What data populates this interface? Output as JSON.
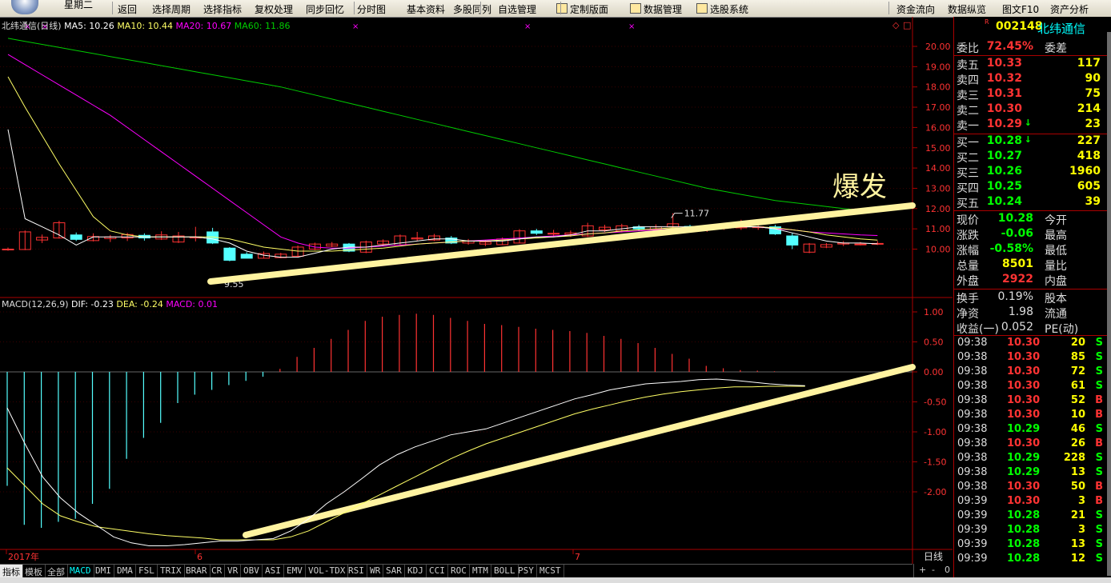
{
  "toolbar": {
    "weekday": "星期二",
    "items": [
      "返回",
      "选择周期",
      "选择指标",
      "复权处理",
      "同步回忆",
      "分时图",
      "基本资料",
      "多股同列",
      "自选管理",
      "定制版面",
      "数据管理",
      "选股系统",
      "资金流向",
      "数据纵览",
      "图文F10",
      "资产分析"
    ]
  },
  "kline_legend": {
    "title": "北纬通信(日线)",
    "ma5": "MA5: 10.26",
    "ma10": "MA10: 10.44",
    "ma20": "MA20: 10.67",
    "ma60": "MA60: 11.86"
  },
  "macd_legend": {
    "title": "MACD(12,26,9)",
    "dif": "DIF: -0.23",
    "dea": "DEA: -0.24",
    "macd": "MACD: 0.01"
  },
  "annotation": "爆发",
  "price_labels": {
    "high": "11.77",
    "low": "9.55"
  },
  "dates": [
    "2017年",
    "6",
    "7"
  ],
  "period_label": "日线",
  "price_axis": [
    "20.00",
    "19.00",
    "18.00",
    "17.00",
    "16.00",
    "15.00",
    "14.00",
    "13.00",
    "12.00",
    "11.00",
    "10.00"
  ],
  "macd_axis": [
    "1.00",
    "0.50",
    "0.00",
    "-0.50",
    "-1.00",
    "-1.50",
    "-2.00"
  ],
  "chart_data": {
    "type": "line",
    "ylim": [
      9.3,
      20.4
    ],
    "candles": [
      {
        "o": 10.0,
        "c": 10.0,
        "h": 10.08,
        "l": 9.92
      },
      {
        "o": 9.98,
        "c": 10.85,
        "h": 10.92,
        "l": 9.95
      },
      {
        "o": 10.45,
        "c": 10.58,
        "h": 10.72,
        "l": 10.3
      },
      {
        "o": 10.55,
        "c": 11.3,
        "h": 11.4,
        "l": 10.52
      },
      {
        "o": 10.7,
        "c": 10.48,
        "h": 10.82,
        "l": 10.4
      },
      {
        "o": 10.42,
        "c": 10.62,
        "h": 10.78,
        "l": 10.38
      },
      {
        "o": 10.52,
        "c": 10.6,
        "h": 10.7,
        "l": 10.35
      },
      {
        "o": 10.55,
        "c": 10.72,
        "h": 10.8,
        "l": 10.4
      },
      {
        "o": 10.68,
        "c": 10.55,
        "h": 10.78,
        "l": 10.42
      },
      {
        "o": 10.5,
        "c": 10.7,
        "h": 10.88,
        "l": 10.45
      },
      {
        "o": 10.35,
        "c": 10.65,
        "h": 10.85,
        "l": 10.3
      },
      {
        "o": 10.55,
        "c": 10.6,
        "h": 11.1,
        "l": 10.38
      },
      {
        "o": 10.85,
        "c": 10.3,
        "h": 11.05,
        "l": 10.25
      },
      {
        "o": 10.05,
        "c": 9.45,
        "h": 10.1,
        "l": 9.4
      },
      {
        "o": 9.75,
        "c": 9.55,
        "h": 9.85,
        "l": 9.55
      },
      {
        "o": 9.55,
        "c": 9.78,
        "h": 9.88,
        "l": 9.55
      },
      {
        "o": 9.58,
        "c": 9.75,
        "h": 9.82,
        "l": 9.55
      },
      {
        "o": 9.65,
        "c": 10.1,
        "h": 10.18,
        "l": 9.62
      },
      {
        "o": 10.0,
        "c": 10.25,
        "h": 10.32,
        "l": 9.95
      },
      {
        "o": 10.15,
        "c": 10.25,
        "h": 10.35,
        "l": 10.1
      },
      {
        "o": 10.25,
        "c": 9.9,
        "h": 10.3,
        "l": 9.85
      },
      {
        "o": 9.85,
        "c": 10.35,
        "h": 10.42,
        "l": 9.8
      },
      {
        "o": 10.25,
        "c": 10.4,
        "h": 10.48,
        "l": 10.15
      },
      {
        "o": 10.2,
        "c": 10.65,
        "h": 10.72,
        "l": 10.18
      },
      {
        "o": 10.5,
        "c": 10.55,
        "h": 10.85,
        "l": 10.4
      },
      {
        "o": 10.45,
        "c": 10.65,
        "h": 10.75,
        "l": 10.4
      },
      {
        "o": 10.55,
        "c": 10.3,
        "h": 10.65,
        "l": 10.25
      },
      {
        "o": 10.3,
        "c": 10.4,
        "h": 10.5,
        "l": 10.22
      },
      {
        "o": 10.25,
        "c": 10.35,
        "h": 10.45,
        "l": 10.15
      },
      {
        "o": 10.22,
        "c": 10.5,
        "h": 10.58,
        "l": 10.2
      },
      {
        "o": 10.3,
        "c": 10.9,
        "h": 10.98,
        "l": 10.28
      },
      {
        "o": 10.9,
        "c": 10.78,
        "h": 11.0,
        "l": 10.7
      },
      {
        "o": 10.75,
        "c": 10.78,
        "h": 10.95,
        "l": 10.62
      },
      {
        "o": 10.72,
        "c": 10.8,
        "h": 10.92,
        "l": 10.6
      },
      {
        "o": 10.65,
        "c": 11.15,
        "h": 11.3,
        "l": 10.6
      },
      {
        "o": 10.95,
        "c": 11.08,
        "h": 11.2,
        "l": 10.85
      },
      {
        "o": 10.9,
        "c": 11.15,
        "h": 11.25,
        "l": 10.82
      },
      {
        "o": 11.1,
        "c": 11.0,
        "h": 11.2,
        "l": 10.9
      },
      {
        "o": 10.98,
        "c": 11.1,
        "h": 11.22,
        "l": 10.88
      },
      {
        "o": 11.1,
        "c": 11.25,
        "h": 11.77,
        "l": 10.95
      },
      {
        "o": 11.12,
        "c": 11.0,
        "h": 11.2,
        "l": 10.9
      },
      {
        "o": 11.0,
        "c": 11.05,
        "h": 11.15,
        "l": 10.85
      },
      {
        "o": 11.05,
        "c": 11.1,
        "h": 11.25,
        "l": 10.95
      },
      {
        "o": 11.05,
        "c": 11.1,
        "h": 11.45,
        "l": 10.95
      },
      {
        "o": 11.1,
        "c": 11.1,
        "h": 11.2,
        "l": 10.95
      },
      {
        "o": 11.1,
        "c": 10.75,
        "h": 11.2,
        "l": 10.7
      },
      {
        "o": 10.65,
        "c": 10.2,
        "h": 10.8,
        "l": 10.0
      },
      {
        "o": 9.85,
        "c": 10.25,
        "h": 10.3,
        "l": 9.8
      },
      {
        "o": 10.1,
        "c": 10.22,
        "h": 10.3,
        "l": 10.05
      },
      {
        "o": 10.25,
        "c": 10.3,
        "h": 10.4,
        "l": 10.15
      },
      {
        "o": 10.22,
        "c": 10.25,
        "h": 10.35,
        "l": 10.18
      },
      {
        "o": 10.25,
        "c": 10.28,
        "h": 10.4,
        "l": 10.2
      }
    ],
    "ma5": [
      15.9,
      11.5,
      11.1,
      10.7,
      10.2,
      10.6,
      10.6,
      10.6,
      10.6,
      10.6,
      10.6,
      10.6,
      10.5,
      10.3,
      9.9,
      9.7,
      9.6,
      9.6,
      9.8,
      10.0,
      10.1,
      10.1,
      10.2,
      10.3,
      10.4,
      10.5,
      10.5,
      10.4,
      10.4,
      10.4,
      10.5,
      10.6,
      10.6,
      10.7,
      10.9,
      10.9,
      11.0,
      11.1,
      11.1,
      11.1,
      11.1,
      11.1,
      11.1,
      11.1,
      11.1,
      11.0,
      10.8,
      10.6,
      10.4,
      10.3,
      10.3,
      10.26
    ],
    "ma10": [
      18.5,
      17.0,
      15.6,
      14.2,
      12.9,
      11.6,
      10.9,
      10.7,
      10.6,
      10.6,
      10.6,
      10.6,
      10.6,
      10.5,
      10.3,
      10.1,
      10.0,
      9.9,
      9.9,
      9.9,
      9.95,
      10.0,
      10.05,
      10.15,
      10.25,
      10.3,
      10.35,
      10.4,
      10.4,
      10.45,
      10.5,
      10.55,
      10.6,
      10.65,
      10.75,
      10.8,
      10.9,
      10.95,
      11.0,
      11.05,
      11.05,
      11.1,
      11.1,
      11.1,
      11.1,
      11.05,
      10.95,
      10.85,
      10.7,
      10.6,
      10.5,
      10.44
    ],
    "ma20": [
      19.6,
      19.1,
      18.6,
      18.1,
      17.6,
      17.1,
      16.6,
      16.0,
      15.4,
      14.8,
      14.2,
      13.6,
      13.0,
      12.4,
      11.8,
      11.2,
      10.6,
      10.3,
      10.1,
      10.05,
      10.05,
      10.1,
      10.15,
      10.2,
      10.25,
      10.3,
      10.35,
      10.4,
      10.45,
      10.5,
      10.55,
      10.6,
      10.65,
      10.7,
      10.75,
      10.8,
      10.85,
      10.9,
      10.95,
      11.0,
      11.0,
      11.05,
      11.05,
      11.1,
      11.1,
      11.0,
      10.95,
      10.85,
      10.8,
      10.75,
      10.7,
      10.67
    ],
    "ma60": [
      20.4,
      20.25,
      20.1,
      19.95,
      19.8,
      19.65,
      19.5,
      19.35,
      19.2,
      19.05,
      18.9,
      18.75,
      18.6,
      18.45,
      18.3,
      18.15,
      18.0,
      17.8,
      17.6,
      17.4,
      17.2,
      17.0,
      16.8,
      16.6,
      16.4,
      16.2,
      16.0,
      15.8,
      15.6,
      15.4,
      15.2,
      15.0,
      14.8,
      14.6,
      14.4,
      14.2,
      14.0,
      13.8,
      13.6,
      13.4,
      13.2,
      13.0,
      12.85,
      12.7,
      12.55,
      12.4,
      12.3,
      12.2,
      12.1,
      12.0,
      11.92,
      11.86
    ],
    "macd_ylim": [
      -2.9,
      1.15
    ],
    "macd_hist": [
      -1.9,
      -2.55,
      -2.6,
      -2.5,
      -2.45,
      -2.2,
      -1.95,
      -1.45,
      -1.1,
      -0.85,
      -0.52,
      -0.38,
      -0.3,
      -0.22,
      -0.15,
      -0.08,
      0.05,
      0.25,
      0.4,
      0.55,
      0.7,
      0.85,
      0.92,
      0.95,
      0.97,
      0.95,
      0.9,
      0.85,
      0.8,
      0.78,
      0.75,
      0.72,
      0.7,
      0.68,
      0.65,
      0.6,
      0.55,
      0.48,
      0.4,
      0.3,
      0.22,
      0.1,
      0.06,
      0.03,
      0.02,
      0.01
    ],
    "dif": [
      -0.6,
      -1.2,
      -1.75,
      -2.1,
      -2.35,
      -2.55,
      -2.75,
      -2.85,
      -2.9,
      -2.9,
      -2.88,
      -2.85,
      -2.82,
      -2.82,
      -2.8,
      -2.78,
      -2.65,
      -2.45,
      -2.2,
      -2.0,
      -1.78,
      -1.55,
      -1.38,
      -1.25,
      -1.15,
      -1.05,
      -1.0,
      -0.95,
      -0.85,
      -0.75,
      -0.65,
      -0.55,
      -0.45,
      -0.38,
      -0.3,
      -0.25,
      -0.2,
      -0.18,
      -0.16,
      -0.13,
      -0.12,
      -0.14,
      -0.17,
      -0.2,
      -0.22,
      -0.23
    ],
    "dea": [
      -1.6,
      -1.9,
      -2.2,
      -2.4,
      -2.5,
      -2.58,
      -2.62,
      -2.66,
      -2.7,
      -2.73,
      -2.75,
      -2.77,
      -2.8,
      -2.8,
      -2.8,
      -2.8,
      -2.75,
      -2.65,
      -2.5,
      -2.35,
      -2.2,
      -2.05,
      -1.9,
      -1.75,
      -1.6,
      -1.45,
      -1.32,
      -1.2,
      -1.1,
      -1.0,
      -0.9,
      -0.8,
      -0.7,
      -0.62,
      -0.55,
      -0.48,
      -0.42,
      -0.37,
      -0.33,
      -0.3,
      -0.27,
      -0.25,
      -0.25,
      -0.24,
      -0.24,
      -0.24
    ]
  },
  "quote": {
    "code": "002148",
    "name": "北纬通信",
    "ratio_label": "委比",
    "ratio_value": "72.45%",
    "diff_label": "委差",
    "asks": [
      {
        "label": "卖五",
        "price": "10.33",
        "vol": "117",
        "arrow": ""
      },
      {
        "label": "卖四",
        "price": "10.32",
        "vol": "90",
        "arrow": ""
      },
      {
        "label": "卖三",
        "price": "10.31",
        "vol": "75",
        "arrow": ""
      },
      {
        "label": "卖二",
        "price": "10.30",
        "vol": "214",
        "arrow": ""
      },
      {
        "label": "卖一",
        "price": "10.29",
        "vol": "23",
        "arrow": "↓"
      }
    ],
    "bids": [
      {
        "label": "买一",
        "price": "10.28",
        "vol": "227",
        "arrow": "↓"
      },
      {
        "label": "买二",
        "price": "10.27",
        "vol": "418",
        "arrow": ""
      },
      {
        "label": "买三",
        "price": "10.26",
        "vol": "1960",
        "arrow": ""
      },
      {
        "label": "买四",
        "price": "10.25",
        "vol": "605",
        "arrow": ""
      },
      {
        "label": "买五",
        "price": "10.24",
        "vol": "39",
        "arrow": ""
      }
    ],
    "stats": [
      {
        "l1": "现价",
        "v1": "10.28",
        "c1": "#0f0",
        "l2": "今开"
      },
      {
        "l1": "涨跌",
        "v1": "-0.06",
        "c1": "#0f0",
        "l2": "最高"
      },
      {
        "l1": "涨幅",
        "v1": "-0.58%",
        "c1": "#0f0",
        "l2": "最低"
      },
      {
        "l1": "总量",
        "v1": "8501",
        "c1": "#ff0",
        "l2": "量比"
      },
      {
        "l1": "外盘",
        "v1": "2922",
        "c1": "#f33",
        "l2": "内盘"
      }
    ],
    "stats2": [
      {
        "l1": "换手",
        "v1": "0.19%",
        "l2": "股本"
      },
      {
        "l1": "净资",
        "v1": "1.98",
        "l2": "流通"
      },
      {
        "l1": "收益(一)",
        "v1": "0.052",
        "l2": "PE(动)"
      }
    ],
    "ticks": [
      {
        "t": "09:38",
        "p": "10.30",
        "v": "20",
        "s": "S"
      },
      {
        "t": "09:38",
        "p": "10.30",
        "v": "85",
        "s": "S"
      },
      {
        "t": "09:38",
        "p": "10.30",
        "v": "72",
        "s": "S"
      },
      {
        "t": "09:38",
        "p": "10.30",
        "v": "61",
        "s": "S"
      },
      {
        "t": "09:38",
        "p": "10.30",
        "v": "52",
        "s": "B"
      },
      {
        "t": "09:38",
        "p": "10.30",
        "v": "10",
        "s": "B"
      },
      {
        "t": "09:38",
        "p": "10.29",
        "v": "46",
        "s": "S"
      },
      {
        "t": "09:38",
        "p": "10.30",
        "v": "26",
        "s": "B"
      },
      {
        "t": "09:38",
        "p": "10.29",
        "v": "228",
        "s": "S"
      },
      {
        "t": "09:38",
        "p": "10.29",
        "v": "13",
        "s": "S"
      },
      {
        "t": "09:38",
        "p": "10.30",
        "v": "50",
        "s": "B"
      },
      {
        "t": "09:39",
        "p": "10.30",
        "v": "3",
        "s": "B"
      },
      {
        "t": "09:39",
        "p": "10.28",
        "v": "21",
        "s": "S"
      },
      {
        "t": "09:39",
        "p": "10.28",
        "v": "3",
        "s": "S"
      },
      {
        "t": "09:39",
        "p": "10.28",
        "v": "13",
        "s": "S"
      },
      {
        "t": "09:39",
        "p": "10.28",
        "v": "12",
        "s": "S"
      }
    ]
  },
  "tabs": [
    "指标",
    "模板",
    "全部",
    "MACD",
    "DMI",
    "DMA",
    "FSL",
    "TRIX",
    "BRAR",
    "CR",
    "VR",
    "OBV",
    "ASI",
    "EMV",
    "VOL-TDX",
    "RSI",
    "WR",
    "SAR",
    "KDJ",
    "CCI",
    "ROC",
    "MTM",
    "BOLL",
    "PSY",
    "MCST"
  ],
  "tab_controls": [
    "+",
    "-",
    "0"
  ],
  "colors": {
    "up": "#ff3232",
    "down": "#54ffff",
    "ma5": "#ffffff",
    "ma10": "#ffff66",
    "ma20": "#ff00ff",
    "ma60": "#00cc00",
    "trend": "#fff3a0"
  }
}
